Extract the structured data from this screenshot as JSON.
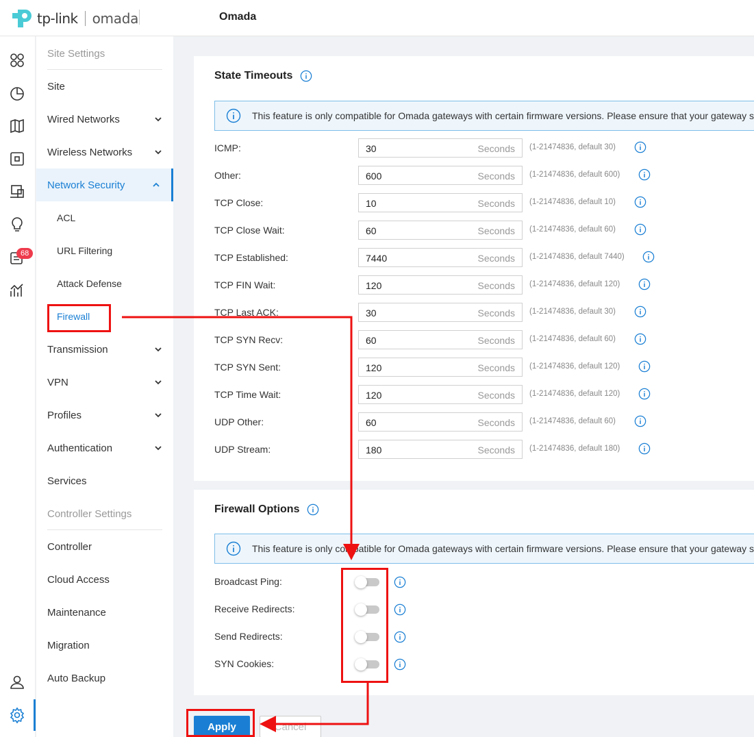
{
  "header": {
    "brand_tplink": "tp-link",
    "brand_omada": "omada",
    "app_title": "Omada"
  },
  "rail": {
    "badge_count": "68",
    "accent": "#1a7fd4",
    "icons": [
      "dashboard-icon",
      "statistics-icon",
      "map-icon",
      "devices-icon",
      "clients-icon",
      "insight-icon",
      "logs-icon",
      "reports-icon",
      "account-icon",
      "settings-icon"
    ]
  },
  "sidebar": {
    "site_settings": "Site Settings",
    "site": "Site",
    "wired_networks": "Wired Networks",
    "wireless_networks": "Wireless Networks",
    "network_security": "Network Security",
    "acl": "ACL",
    "url_filtering": "URL Filtering",
    "attack_defense": "Attack Defense",
    "firewall": "Firewall",
    "transmission": "Transmission",
    "vpn": "VPN",
    "profiles": "Profiles",
    "authentication": "Authentication",
    "services": "Services",
    "controller_settings": "Controller Settings",
    "controller": "Controller",
    "cloud_access": "Cloud Access",
    "maintenance": "Maintenance",
    "migration": "Migration",
    "auto_backup": "Auto Backup"
  },
  "state_timeouts": {
    "title": "State Timeouts",
    "notice": "This feature is only compatible for Omada gateways with certain firmware versions. Please ensure that your gateway s",
    "unit": "Seconds",
    "rows": [
      {
        "label": "ICMP:",
        "value": "30",
        "hint": "(1-21474836, default 30)"
      },
      {
        "label": "Other:",
        "value": "600",
        "hint": "(1-21474836, default 600)"
      },
      {
        "label": "TCP Close:",
        "value": "10",
        "hint": "(1-21474836, default 10)"
      },
      {
        "label": "TCP Close Wait:",
        "value": "60",
        "hint": "(1-21474836, default 60)"
      },
      {
        "label": "TCP Established:",
        "value": "7440",
        "hint": "(1-21474836, default 7440)"
      },
      {
        "label": "TCP FIN Wait:",
        "value": "120",
        "hint": "(1-21474836, default 120)"
      },
      {
        "label": "TCP Last ACK:",
        "value": "30",
        "hint": "(1-21474836, default 30)"
      },
      {
        "label": "TCP SYN Recv:",
        "value": "60",
        "hint": "(1-21474836, default 60)"
      },
      {
        "label": "TCP SYN Sent:",
        "value": "120",
        "hint": "(1-21474836, default 120)"
      },
      {
        "label": "TCP Time Wait:",
        "value": "120",
        "hint": "(1-21474836, default 120)"
      },
      {
        "label": "UDP Other:",
        "value": "60",
        "hint": "(1-21474836, default 60)"
      },
      {
        "label": "UDP Stream:",
        "value": "180",
        "hint": "(1-21474836, default 180)"
      }
    ]
  },
  "firewall_options": {
    "title": "Firewall Options",
    "notice": "This feature is only compatible for Omada gateways with certain firmware versions. Please ensure that your gateway s",
    "toggles": [
      {
        "label": "Broadcast Ping:",
        "enabled": false
      },
      {
        "label": "Receive Redirects:",
        "enabled": false
      },
      {
        "label": "Send Redirects:",
        "enabled": false
      },
      {
        "label": "SYN Cookies:",
        "enabled": false
      }
    ]
  },
  "actions": {
    "apply": "Apply",
    "cancel": "Cancel"
  },
  "annotation_color": "#e11111"
}
